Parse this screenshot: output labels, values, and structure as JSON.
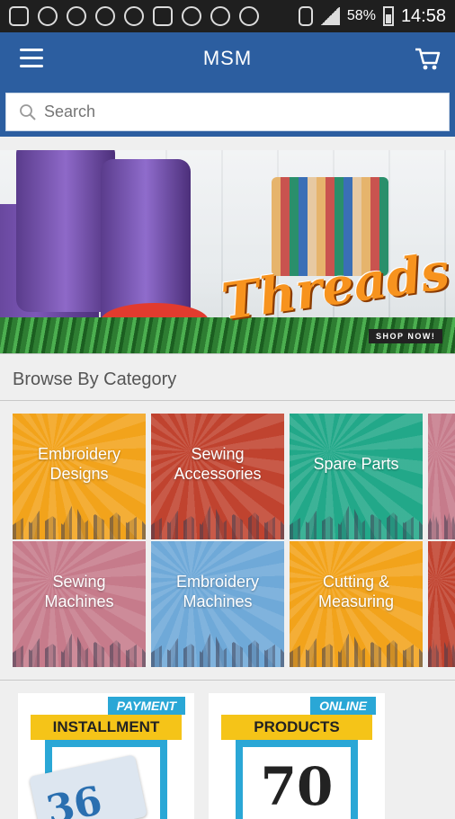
{
  "status_bar": {
    "battery": "58%",
    "time": "14:58",
    "icons": [
      "gallery-icon",
      "sync-icon",
      "usb-icon",
      "usb-icon",
      "alarm-icon",
      "briefcase-icon",
      "mute-icon",
      "alarm-icon",
      "wifi-icon",
      "sim-icon",
      "signal-icon"
    ]
  },
  "app_bar": {
    "title": "MSM",
    "menu_icon": "hamburger-menu-icon",
    "cart_icon": "shopping-cart-icon"
  },
  "search": {
    "placeholder": "Search"
  },
  "banner": {
    "headline": "Threads",
    "cta": "SHOP NOW!"
  },
  "browse": {
    "title": "Browse By Category",
    "categories": [
      {
        "label": "Embroidery Designs",
        "color": "#f2a31b"
      },
      {
        "label": "Sewing Accessories",
        "color": "#c0432f"
      },
      {
        "label": "Spare Parts",
        "color": "#22a889"
      },
      {
        "label": "Sewing Machines",
        "color": "#c67b8b"
      },
      {
        "label": "Embroidery Machines",
        "color": "#6fa9d8"
      },
      {
        "label": "Cutting & Measuring",
        "color": "#f2a31b"
      }
    ]
  },
  "promos": [
    {
      "tag_top": "PAYMENT",
      "tag_main": "INSTALLMENT",
      "number": "36"
    },
    {
      "tag_top": "ONLINE",
      "tag_main": "PRODUCTS",
      "number": "70"
    }
  ]
}
